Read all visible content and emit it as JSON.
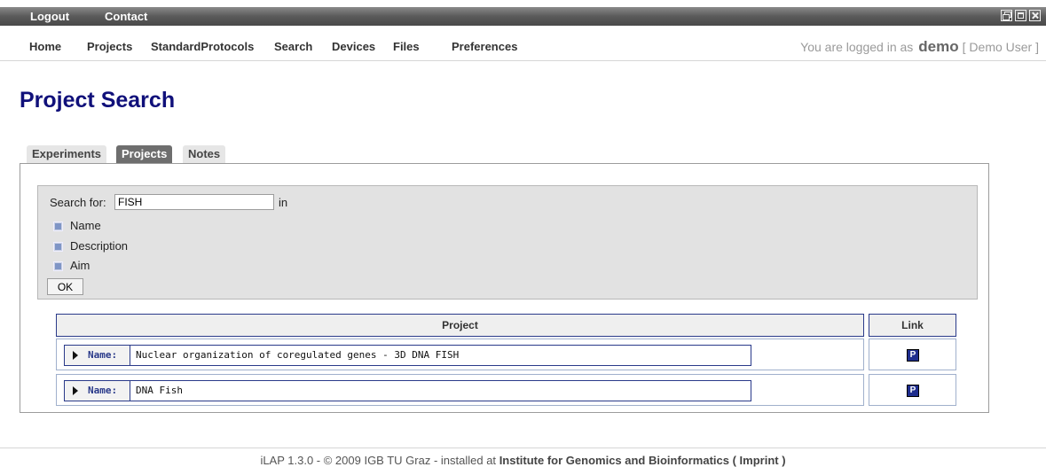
{
  "topbar": {
    "links": [
      "Logout",
      "Contact"
    ]
  },
  "nav": {
    "items": [
      "Home",
      "Projects",
      "StandardProtocols",
      "Search",
      "Devices",
      "Files",
      "Preferences"
    ],
    "login_prefix": "You are logged in as",
    "username": "demo",
    "fullname": "[ Demo User ]"
  },
  "page": {
    "title": "Project Search"
  },
  "tabs": [
    {
      "label": "Experiments",
      "active": false
    },
    {
      "label": "Projects",
      "active": true
    },
    {
      "label": "Notes",
      "active": false
    }
  ],
  "search": {
    "label": "Search for:",
    "value": "FISH",
    "in_label": "in",
    "fields": [
      "Name",
      "Description",
      "Aim"
    ],
    "ok_label": "OK"
  },
  "results": {
    "headers": {
      "project": "Project",
      "link": "Link"
    },
    "name_label": "Name:",
    "link_icon_text": "P",
    "rows": [
      {
        "name": "Nuclear organization of coregulated genes - 3D DNA FISH"
      },
      {
        "name": "DNA Fish"
      }
    ]
  },
  "footer": {
    "text": "iLAP 1.3.0 - © 2009 IGB TU Graz - installed at",
    "institute": "Institute for Genomics and Bioinformatics ( Imprint )"
  },
  "colors": {
    "title": "#10107a",
    "table_border": "#2a3a8a",
    "link_icon": "#1e2d8e"
  }
}
